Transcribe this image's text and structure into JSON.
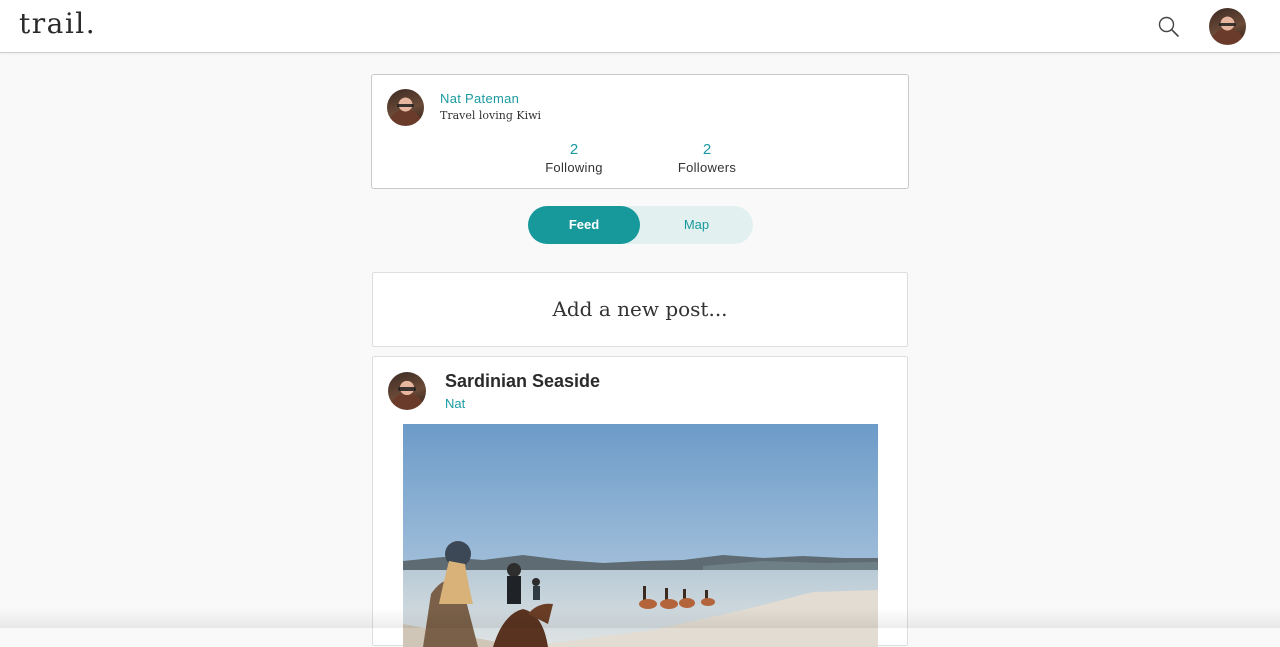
{
  "header": {
    "logo": "trail.",
    "search_icon": "search-icon",
    "avatar_icon": "user-avatar"
  },
  "profile": {
    "name": "Nat Pateman",
    "bio": "Travel loving Kiwi",
    "following_count": "2",
    "following_label": "Following",
    "followers_count": "2",
    "followers_label": "Followers"
  },
  "view_toggle": {
    "active": "Feed",
    "feed_label": "Feed",
    "map_label": "Map"
  },
  "new_post": {
    "prompt": "Add a new post..."
  },
  "feed": {
    "posts": [
      {
        "title": "Sardinian Seaside",
        "author": "Nat"
      }
    ]
  },
  "colors": {
    "accent": "#17999c",
    "toggle_bg": "#e2f0f0",
    "background": "#f9f9f9"
  }
}
